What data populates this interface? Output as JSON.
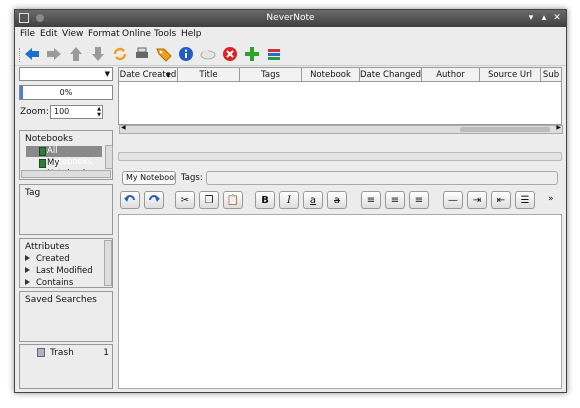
{
  "window": {
    "title": "NeverNote"
  },
  "menu": [
    "File",
    "Edit",
    "View",
    "Format",
    "Online",
    "Tools",
    "Help"
  ],
  "left": {
    "notebook_combo": "",
    "progress_text": "0%",
    "progress_value": 0.0,
    "zoom_label": "Zoom:",
    "zoom_value": "100",
    "notebooks_header": "Notebooks",
    "notebooks": [
      "All Notebooks",
      "My Notebook"
    ],
    "tag_header": "Tag",
    "attributes_header": "Attributes",
    "attributes": [
      "Created",
      "Last Modified",
      "Contains"
    ],
    "saved_searches_header": "Saved Searches",
    "trash_label": "Trash",
    "trash_count": "1"
  },
  "table": {
    "columns": [
      "Date Created",
      "Title",
      "Tags",
      "Notebook",
      "Date Changed",
      "Author",
      "Source Url",
      "Sub"
    ]
  },
  "editor": {
    "notebook_select": "My Notebook",
    "tags_label": "Tags:",
    "tags_value": "",
    "more_label": "»"
  },
  "colors": {
    "titlebar": "#4a4a4a",
    "selection": "#8a8a8a",
    "accent": "#4a7fd4"
  }
}
